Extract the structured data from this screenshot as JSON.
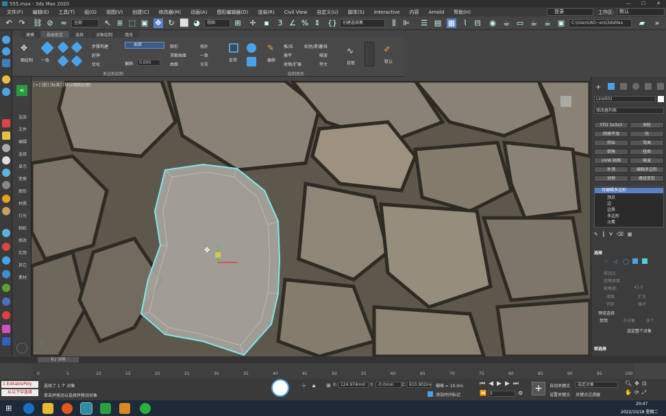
{
  "window": {
    "title": "555.max - 3ds Max 2020",
    "minimize": "—",
    "maximize": "☐",
    "close": "✕"
  },
  "menu": [
    "文件(F)",
    "编辑(E)",
    "工具(T)",
    "组(G)",
    "视图(V)",
    "创建(C)",
    "修改器(M)",
    "动画(A)",
    "图形编辑器(D)",
    "渲染(R)",
    "Civil View",
    "自定义(U)",
    "脚本(S)",
    "Interactive",
    "内容",
    "Arnold",
    "帮助(H)"
  ],
  "account": {
    "user": "登录",
    "workspace_label": "工作区:",
    "workspace_value": "默认"
  },
  "toolbar": {
    "filter": "全部",
    "view_ref": "视图",
    "selection_set": "创建选择集",
    "path": "C:\\Users\\AO~ers\\3dsMax"
  },
  "ribbon": {
    "tabs": [
      "建模",
      "自由形式",
      "选择",
      "对象绘制",
      "填充"
    ],
    "active_tab": "自由形式",
    "tools": {
      "polydraw": "面绘制",
      "one": "一致",
      "step_build": "步骤构建",
      "extend": "延伸",
      "optimize": "优化",
      "mode": "曲面",
      "offset_label": "偏移:",
      "offset_value": "0.000",
      "shapes": "图形",
      "solve_surface": "求解曲面",
      "surface": "曲面",
      "topology": "拓扑",
      "conform": "一致",
      "branches": "分支",
      "strips": "条带",
      "shift": "偏移",
      "paint_deform": "推/拉",
      "relax": "松弛/柔化",
      "smudge": "涂抹",
      "flatten": "展平",
      "pinch": "收缩/扩展",
      "noise": "噪波",
      "exaggerate": "夸大",
      "revert": "还原",
      "pick": "拾取",
      "default": "默认"
    },
    "groups": [
      "多边形绘制",
      "绘制变形"
    ]
  },
  "left_labels": [
    "渲染",
    "文件",
    "编辑",
    "选择",
    "显示",
    "变换",
    "图形",
    "材质",
    "灯光",
    "相机",
    "修改",
    "实用",
    "其它",
    "素材"
  ],
  "viewport": {
    "label": "[+] [前] [标准] [默认明暗处理]"
  },
  "command_panel": {
    "object_name": "Line001",
    "modifier_list": "修改器列表",
    "buttons": [
      [
        "FFD 3x3x3",
        "涡轮"
      ],
      [
        "网格平滑",
        "壳"
      ],
      [
        "挤出",
        "弯曲"
      ],
      [
        "倒角",
        "扭曲"
      ],
      [
        "UVW 贴图",
        "噪波"
      ],
      [
        "补洞",
        "编辑多边形"
      ],
      [
        "对称",
        "路径变形"
      ]
    ],
    "stack": [
      "可编辑多边形",
      "顶点",
      "边",
      "边界",
      "多边形",
      "元素"
    ],
    "selection_title": "选择",
    "by_vertex": "按顶点",
    "ignore_backfacing": "忽略背面",
    "by_angle": "按角度:",
    "angle_value": "45.0",
    "shrink": "收缩",
    "grow": "扩大",
    "ring": "环形",
    "loop": "循环",
    "preview_title": "预览选择",
    "preview_off": "禁用",
    "preview_sub": "子对象",
    "preview_multi": "多个",
    "selected": "选定整个对象",
    "soft_sel": "软选择"
  },
  "timeline": {
    "frame": "0 / 100",
    "ticks": [
      "0",
      "5",
      "10",
      "15",
      "20",
      "25",
      "30",
      "35",
      "40",
      "45",
      "50",
      "55",
      "60",
      "65",
      "70",
      "75",
      "80",
      "85",
      "90",
      "95",
      "100"
    ]
  },
  "status": {
    "script_label": "1 EditablePoly",
    "script_sub": "从以下中选择",
    "selected": "选择了 1 个 对象",
    "hint": "单击并拖动以选择并移动对象",
    "x": "124.974mm",
    "y": "-0.0mm",
    "z": "610.902mm",
    "grid": "栅格 = 10.0m",
    "add_tag": "添加时间标记",
    "autokey": "自动关键点",
    "selected_obj": "选定对象",
    "setkey": "设置关键点",
    "key_filter": "关键点过滤器",
    "frame_field": "0"
  },
  "taskbar": {
    "time": "20:47",
    "date": "2022/10/18 星期二"
  },
  "colors": {
    "accent": "#4aa3e8",
    "selection": "#7fe8f0",
    "active_stack": "#5b7fc7"
  }
}
